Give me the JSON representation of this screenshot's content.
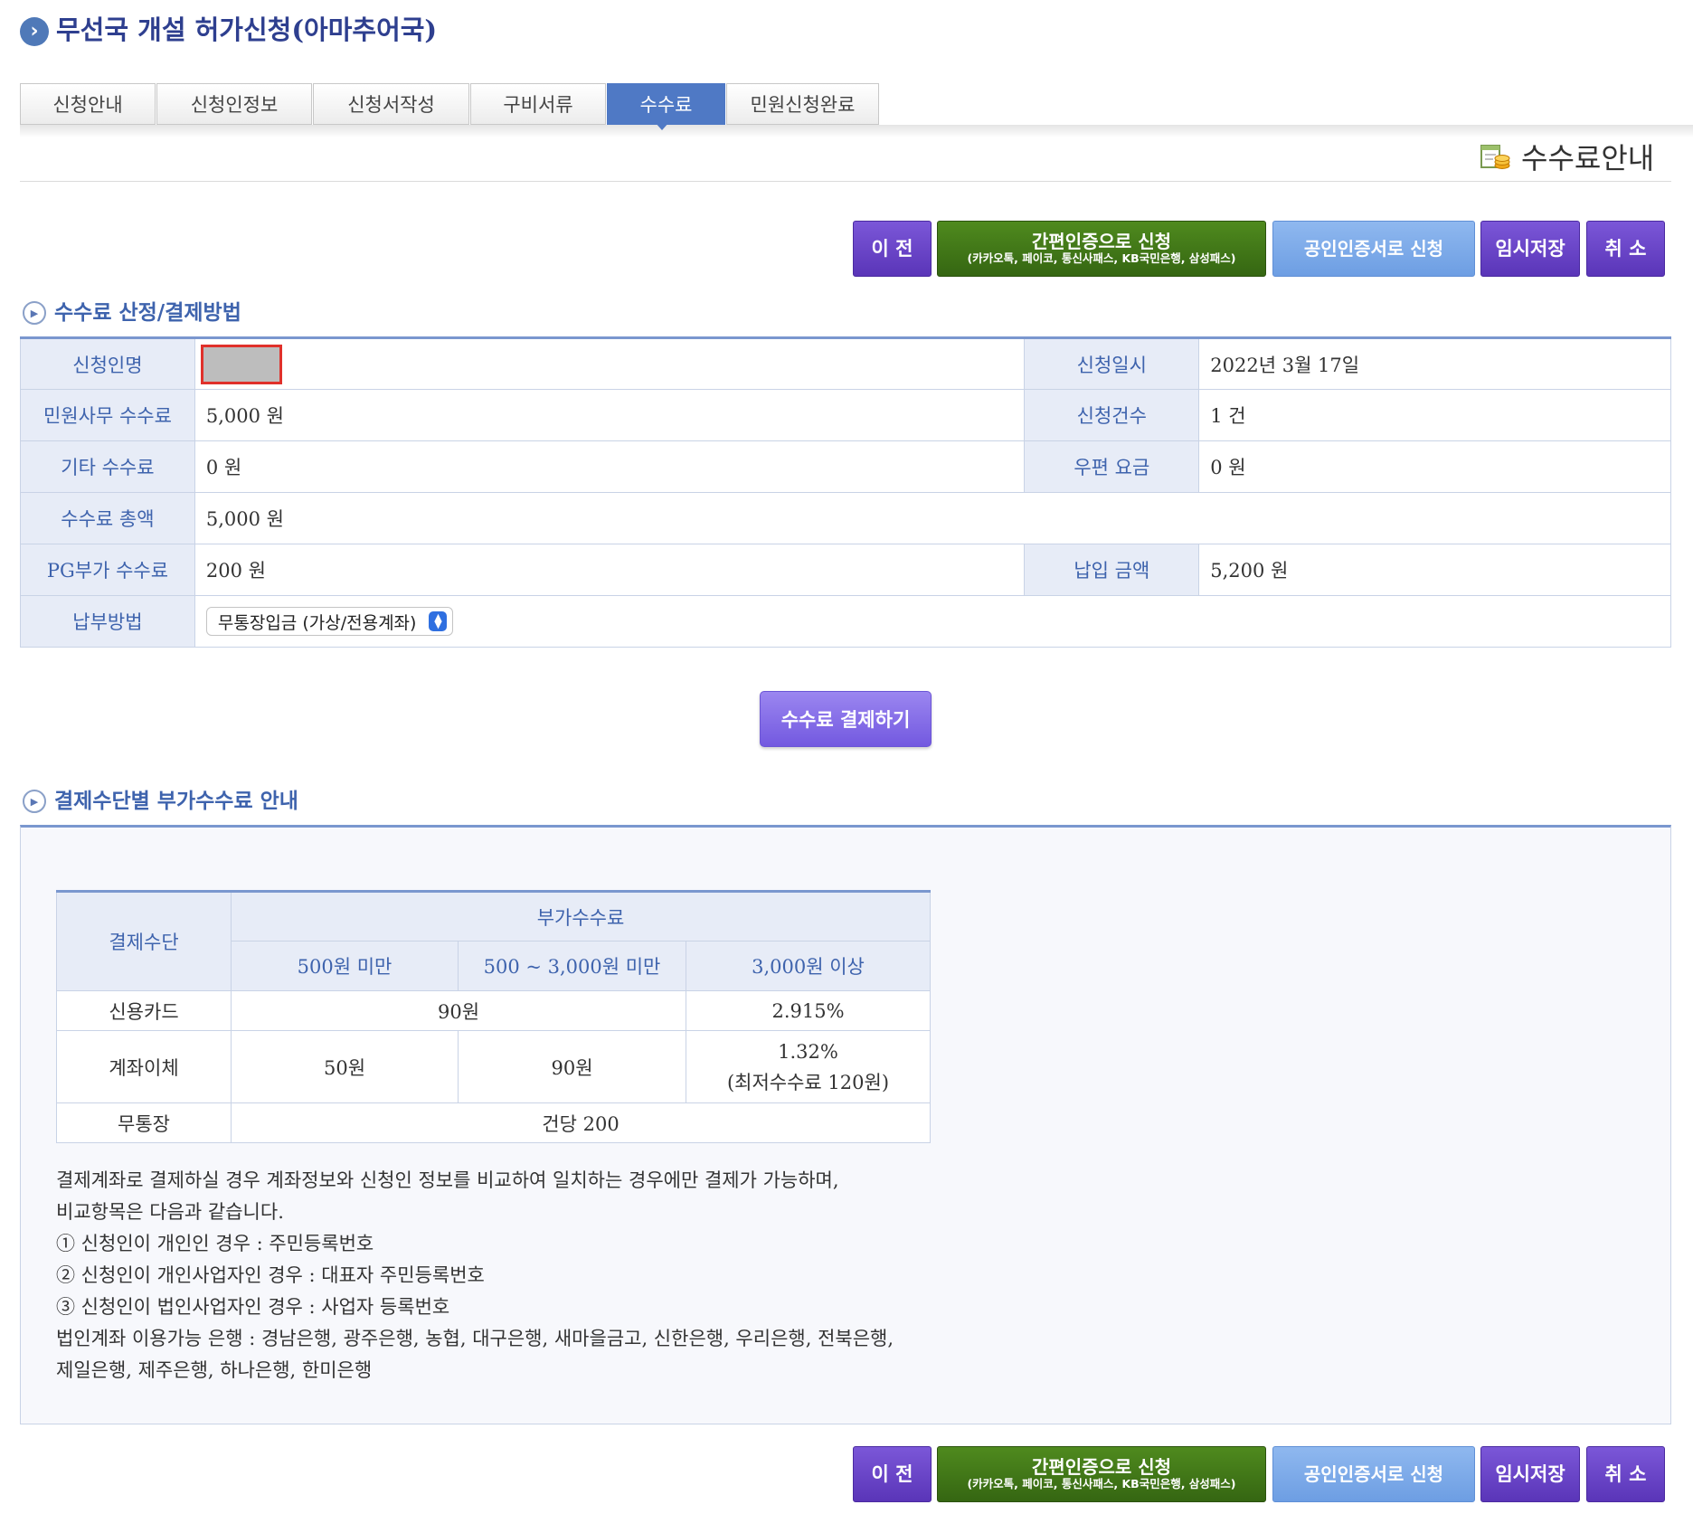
{
  "page": {
    "title": "무선국 개설 허가신청(아마추어국)",
    "title_icon": "chevron-right-icon"
  },
  "tabs": [
    {
      "label": "신청안내"
    },
    {
      "label": "신청인정보"
    },
    {
      "label": "신청서작성"
    },
    {
      "label": "구비서류"
    },
    {
      "label": "수수료",
      "active": true
    },
    {
      "label": "민원신청완료"
    }
  ],
  "guide": {
    "label": "수수료안내",
    "icon": "fee-guide-icon"
  },
  "actions": {
    "prev": "이 전",
    "simple_auth_line1": "간편인증으로 신청",
    "simple_auth_line2": "(카카오톡, 페이코, 통신사패스, KB국민은행, 삼성패스)",
    "cert_apply": "공인인증서로 신청",
    "temp_save": "임시저장",
    "cancel": "취 소"
  },
  "section1": {
    "title": "수수료 산정/결제방법",
    "applicant_label": "신청인명",
    "date_label": "신청일시",
    "date_value": "2022년 3월 17일",
    "civil_fee_label": "민원사무 수수료",
    "civil_fee_value": "5,000 원",
    "count_label": "신청건수",
    "count_value": "1 건",
    "other_fee_label": "기타 수수료",
    "other_fee_value": "0 원",
    "postal_label": "우편 요금",
    "postal_value": "0 원",
    "total_label": "수수료 총액",
    "total_value": "5,000 원",
    "pg_label": "PG부가 수수료",
    "pg_value": "200 원",
    "pay_amount_label": "납입 금액",
    "pay_amount_value": "5,200 원",
    "method_label": "납부방법",
    "method_selected": "무통장입금 (가상/전용계좌)"
  },
  "pay_button": "수수료 결제하기",
  "section2": {
    "title": "결제수단별 부가수수료 안내",
    "header_method": "결제수단",
    "header_fee": "부가수수료",
    "ranges": [
      "500원 미만",
      "500 ~ 3,000원 미만",
      "3,000원 이상"
    ],
    "rows": {
      "card": {
        "method": "신용카드",
        "low_mid": "90원",
        "high": "2.915%"
      },
      "transfer": {
        "method": "계좌이체",
        "low": "50원",
        "mid": "90원",
        "high_line1": "1.32%",
        "high_line2": "(최저수수료 120원)"
      },
      "deposit": {
        "method": "무통장",
        "all": "건당 200"
      }
    },
    "notes": [
      "결제계좌로 결제하실 경우 계좌정보와 신청인 정보를 비교하여 일치하는 경우에만 결제가 가능하며,",
      "비교항목은 다음과 같습니다.",
      "① 신청인이 개인인 경우 : 주민등록번호",
      "② 신청인이 개인사업자인 경우 : 대표자 주민등록번호",
      "③ 신청인이 법인사업자인 경우 : 사업자 등록번호",
      "법인계좌 이용가능 은행 : 경남은행, 광주은행, 농협, 대구은행, 새마을금고, 신한은행, 우리은행, 전북은행,",
      "제일은행, 제주은행, 하나은행, 한미은행"
    ]
  },
  "colors": {
    "brand_blue": "#4f79c5",
    "label_text": "#3e63ad",
    "label_bg": "#e7ecf7",
    "purple_button": "#5a35b8",
    "green_button": "#356612",
    "blue_button": "#6d9ee3",
    "redaction_border": "#e0312b"
  }
}
